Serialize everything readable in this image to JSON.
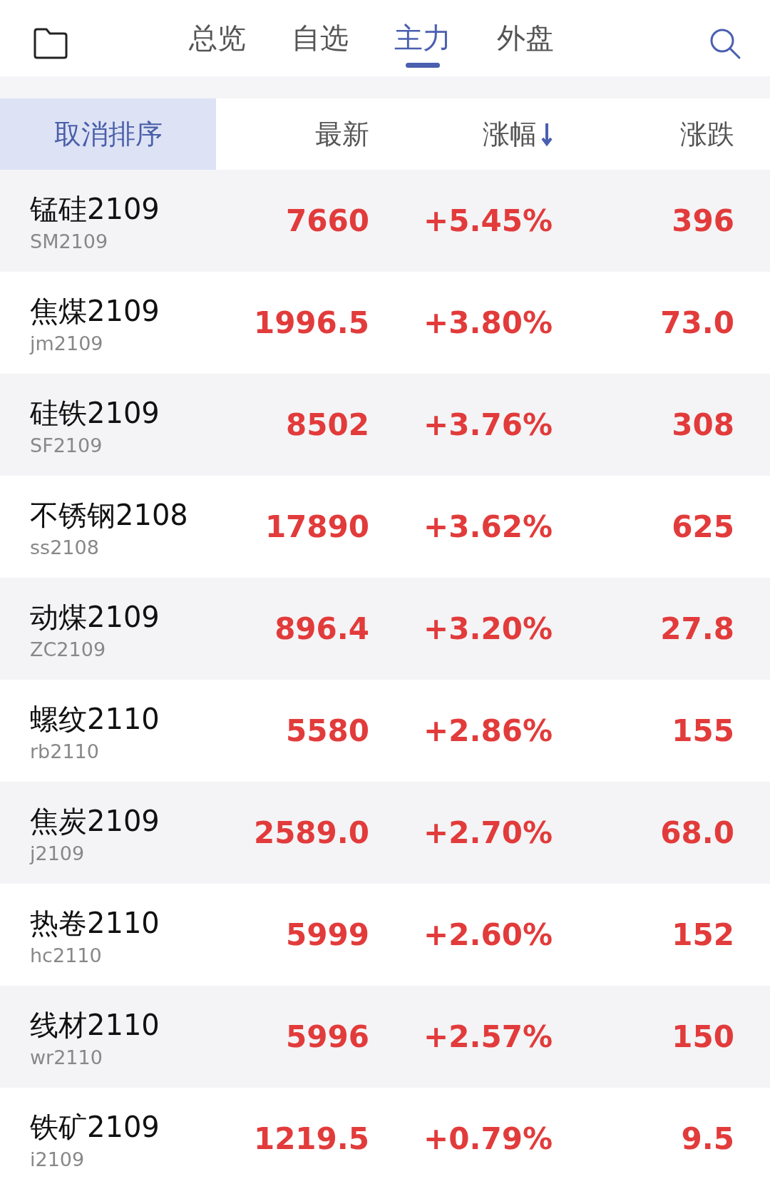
{
  "tabs": [
    {
      "label": "总览",
      "selected": false
    },
    {
      "label": "自选",
      "selected": false
    },
    {
      "label": "主力",
      "selected": true
    },
    {
      "label": "外盘",
      "selected": false
    }
  ],
  "sort_header": {
    "cancel_label": "取消排序",
    "columns": [
      {
        "label": "最新",
        "sorted": false
      },
      {
        "label": "涨幅",
        "sorted": true
      },
      {
        "label": "涨跌",
        "sorted": false
      }
    ]
  },
  "rows": [
    {
      "name": "锰硅2109",
      "code": "SM2109",
      "latest": "7660",
      "change_pct": "+5.45%",
      "change": "396",
      "rising": true
    },
    {
      "name": "焦煤2109",
      "code": "jm2109",
      "latest": "1996.5",
      "change_pct": "+3.80%",
      "change": "73.0",
      "rising": true
    },
    {
      "name": "硅铁2109",
      "code": "SF2109",
      "latest": "8502",
      "change_pct": "+3.76%",
      "change": "308",
      "rising": true
    },
    {
      "name": "不锈钢2108",
      "code": "ss2108",
      "latest": "17890",
      "change_pct": "+3.62%",
      "change": "625",
      "rising": true
    },
    {
      "name": "动煤2109",
      "code": "ZC2109",
      "latest": "896.4",
      "change_pct": "+3.20%",
      "change": "27.8",
      "rising": true
    },
    {
      "name": "螺纹2110",
      "code": "rb2110",
      "latest": "5580",
      "change_pct": "+2.86%",
      "change": "155",
      "rising": true
    },
    {
      "name": "焦炭2109",
      "code": "j2109",
      "latest": "2589.0",
      "change_pct": "+2.70%",
      "change": "68.0",
      "rising": true
    },
    {
      "name": "热卷2110",
      "code": "hc2110",
      "latest": "5999",
      "change_pct": "+2.60%",
      "change": "152",
      "rising": true
    },
    {
      "name": "线材2110",
      "code": "wr2110",
      "latest": "5996",
      "change_pct": "+2.57%",
      "change": "150",
      "rising": true
    },
    {
      "name": "铁矿2109",
      "code": "i2109",
      "latest": "1219.5",
      "change_pct": "+0.79%",
      "change": "9.5",
      "rising": true
    }
  ]
}
